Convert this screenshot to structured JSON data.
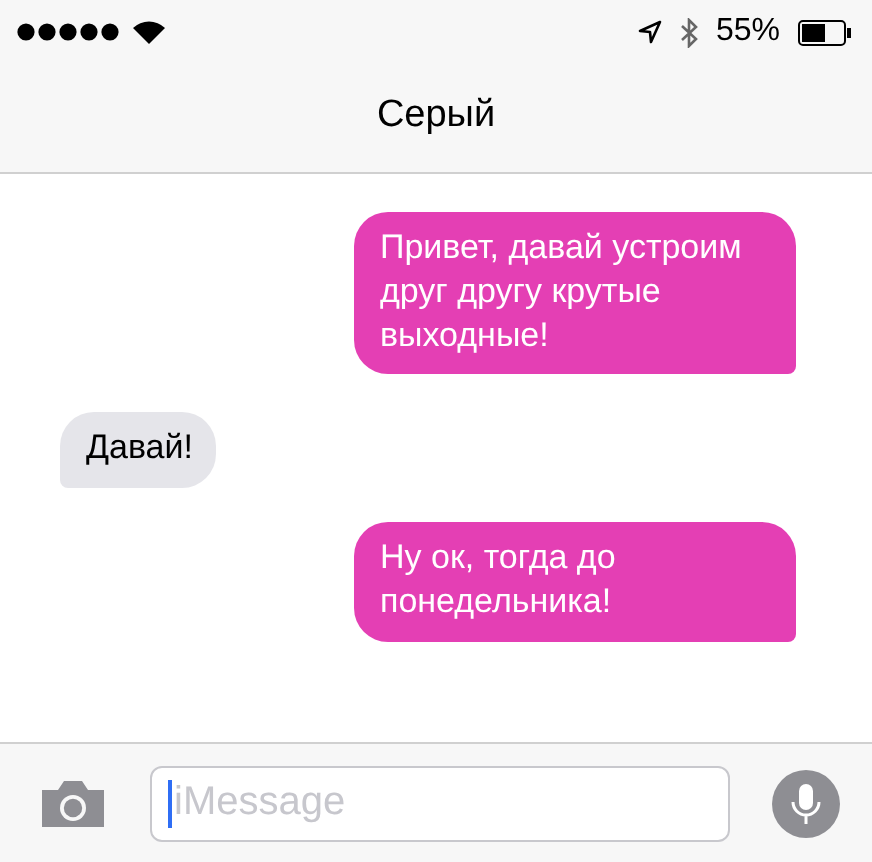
{
  "status_bar": {
    "battery": "55%"
  },
  "nav": {
    "title": "Серый"
  },
  "messages": [
    {
      "kind": "outgoing",
      "text": "Привет, давай устроим друг другу крутые выходные!"
    },
    {
      "kind": "incoming",
      "text": "Давай!"
    },
    {
      "kind": "outgoing",
      "text": "Ну ок, тогда до понедельника!"
    }
  ],
  "composer": {
    "placeholder": "iMessage"
  }
}
